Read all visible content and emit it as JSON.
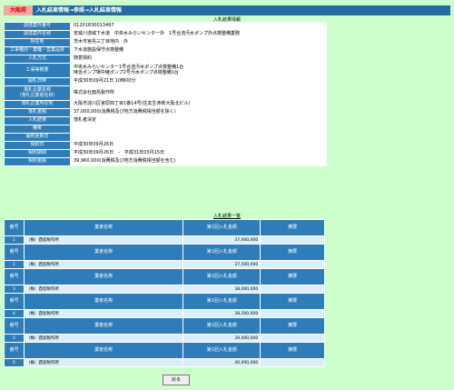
{
  "header": {
    "prefecture": "大阪府",
    "breadcrumb": "入札結果情報→参照→入札結果情報"
  },
  "detail_title": "入札結果情報",
  "detail_rows": [
    {
      "label": "調達案件番号",
      "value": "01201830013497"
    },
    {
      "label": "調達案件名称",
      "value": "安威川流域下水道　中央水みらいセンター外　1号合流汚水ポンプ外点検整備業務"
    },
    {
      "label": "所在地",
      "value": "茨木市宮島三丁目地内　外"
    },
    {
      "label": "工事種別・業種・営業品目",
      "value": "下水道施設保守点検整備"
    },
    {
      "label": "入札方式",
      "value": "随意契約"
    },
    {
      "label": "工事等概要",
      "value": "中央水みらいセンター1号合流汚水ポンプ点検整備1台\n味舌ポンプ場中継ポンプ2号汚水ポンプ点検整備1台"
    },
    {
      "label": "開札日時",
      "value": "平成30年09月21日 10時00分"
    },
    {
      "label": "落札企業名称\n（落札企業者名称）",
      "value": "株式会社酉島製作所"
    },
    {
      "label": "落札企業所在地",
      "value": "大阪市淀川区宮原四丁目1番14号(住友生命新大阪北ビル)"
    },
    {
      "label": "落札金額",
      "value": "37,000,000(消費税及び地方消費税相当額を除く)"
    },
    {
      "label": "入札結果",
      "value": "落札者決定"
    },
    {
      "label": "備考",
      "value": ""
    },
    {
      "label": "最終更新日",
      "value": ""
    },
    {
      "label": "契約日",
      "value": "平成30年09月26日"
    },
    {
      "label": "契約期間",
      "value": "平成30年09月26日　-　平成31年03月15日"
    },
    {
      "label": "契約金額",
      "value": "39,960,000(消費税及び地方消費税相当額を含む)"
    }
  ],
  "results_title": "入札結果一覧",
  "results_headers": {
    "num": "番号",
    "name": "業者名称",
    "amount": "第1回入札金額",
    "remarks": "摘要"
  },
  "results_rows": [
    {
      "num": "1",
      "name": "（株）酉島製作所",
      "amount": "37,000,000",
      "remarks": ""
    },
    {
      "num": "2",
      "name": "（株）酉島製作所",
      "amount": "37,500,000",
      "remarks": ""
    },
    {
      "num": "3",
      "name": "（株）酉島製作所",
      "amount": "38,000,000",
      "remarks": ""
    },
    {
      "num": "4",
      "name": "（株）酉島製作所",
      "amount": "38,500,000",
      "remarks": ""
    },
    {
      "num": "5",
      "name": "（株）酉島製作所",
      "amount": "39,000,000",
      "remarks": ""
    },
    {
      "num": "6",
      "name": "（株）酉島製作所",
      "amount": "40,000,000",
      "remarks": ""
    }
  ],
  "back_button": "戻る"
}
